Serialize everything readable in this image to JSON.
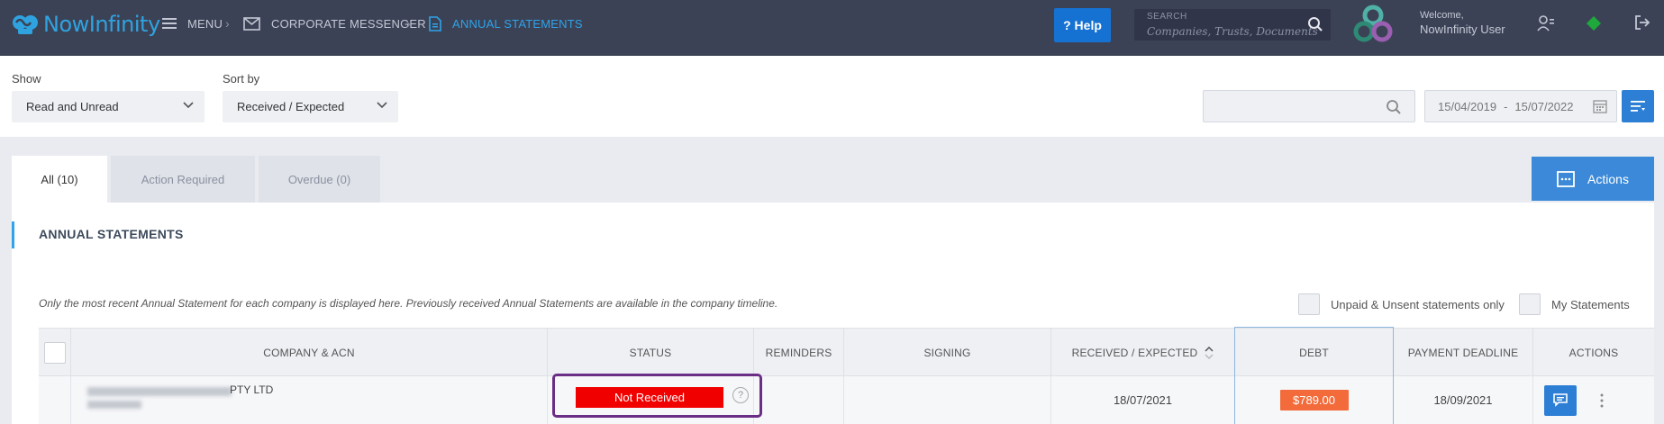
{
  "brand": {
    "name": "NowInfinity",
    "color": "#2fa3e0"
  },
  "nav": {
    "menu_label": "MENU",
    "crumb1": "CORPORATE MESSENGER",
    "crumb2": "ANNUAL STATEMENTS",
    "separator": "›"
  },
  "header": {
    "help_label": "? Help",
    "search_label": "SEARCH",
    "search_placeholder": "Companies,  Trusts,  Documents",
    "welcome": "Welcome,",
    "user": "NowInfinity User"
  },
  "filters": {
    "show_label": "Show",
    "show_value": "Read and Unread",
    "sort_label": "Sort by",
    "sort_value": "Received / Expected",
    "search_value": "",
    "date_from": "15/04/2019",
    "date_to": "15/07/2022",
    "date_sep": "-"
  },
  "tabs": [
    {
      "label": "All (10)",
      "active": true
    },
    {
      "label": "Action Required",
      "active": false
    },
    {
      "label": "Overdue (0)",
      "active": false
    }
  ],
  "actions_label": "Actions",
  "panel": {
    "title": "ANNUAL STATEMENTS",
    "note": "Only the most recent Annual Statement for each company is displayed here. Previously received Annual Statements are available in the company timeline.",
    "filter_unpaid": "Unpaid & Unsent statements only",
    "filter_mine": "My Statements"
  },
  "table": {
    "columns": [
      "COMPANY & ACN",
      "STATUS",
      "REMINDERS",
      "SIGNING",
      "RECEIVED / EXPECTED",
      "DEBT",
      "PAYMENT DEADLINE",
      "ACTIONS"
    ],
    "rows": [
      {
        "company": "PTY LTD",
        "status": "Not Received",
        "reminders": "",
        "signing": "",
        "received": "18/07/2021",
        "debt": "$789.00",
        "deadline": "18/09/2021"
      }
    ]
  },
  "colors": {
    "topbar": "#3c4256",
    "accent": "#2ea3e8",
    "status_red": "#f10000",
    "debt_orange": "#f36b3a",
    "highlight": "#6b2e86"
  }
}
